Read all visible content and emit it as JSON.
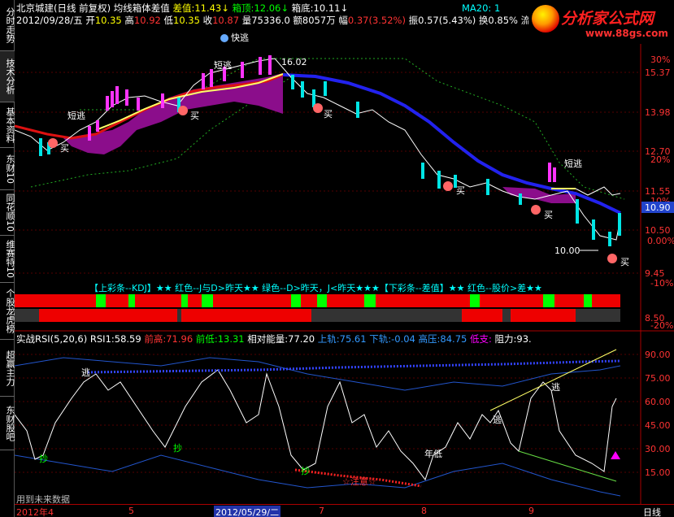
{
  "sidebar": {
    "tabs": [
      "分时走势",
      "技术分析",
      "基本资料",
      "东财10",
      "同花顺10",
      "维赛特10",
      "个股龙虎榜",
      "超赢主力",
      "东财股吧"
    ]
  },
  "header": {
    "stock": "北京城建(日线 前复权)",
    "indicator": "均线箱体差值",
    "diff_label": "差值:",
    "diff_value": "11.43",
    "top_label": "箱顶:",
    "top_value": "12.06",
    "bottom_label": "箱底:",
    "bottom_value": "10.11",
    "date": "2012/09/28/五",
    "open_label": "开",
    "open": "10.35",
    "high_label": "高",
    "high": "10.92",
    "low_label": "低",
    "low": "10.35",
    "close_label": "收",
    "close": "10.87",
    "vol_label": "量",
    "vol": "75336.0",
    "amt_label": "额",
    "amt": "8057万",
    "chg_label": "幅",
    "chg": "0.37(3.52%)",
    "amp_label": "振",
    "amp": "0.57(5.43%)",
    "turn_label": "换",
    "turn": "0.85%",
    "flow_label": "流"
  },
  "ma20": "MA20: 1",
  "logo": {
    "title": "分析家公式网",
    "url": "www.88gs.com"
  },
  "price_axis": [
    "15.37",
    "13.98",
    "12.70",
    "11.55",
    "10.50",
    "9.45",
    "8.50"
  ],
  "pct_axis": [
    "30%",
    "20%",
    "10%",
    "0.00%",
    "-10%",
    "-20%"
  ],
  "current_price": "10.90",
  "annotations": {
    "kuaitao": "快逃",
    "duantao": "短逃",
    "buy": "买",
    "high_mark": "16.02",
    "low_mark": "10.00"
  },
  "banner": "【上彩条--KDJ】★★ 红色--J与D>昨天★★ 绿色--D>昨天，J<昨天★★★【下彩条--差值】★★ 红色--股价>差★★",
  "rsi": {
    "name": "实战RSI(5,20,6)",
    "rsi1_label": "RSI1:",
    "rsi1": "58.59",
    "prev_high_label": "前高:",
    "prev_high": "71.96",
    "prev_low_label": "前低:",
    "prev_low": "13.31",
    "rel_label": "相对能量:",
    "rel": "77.20",
    "upper_label": "上轨:",
    "upper": "75.61",
    "lower_label": "下轨:",
    "lower": "-0.04",
    "high_press_label": "高压:",
    "high_press": "84.75",
    "low_support_label": "低支:",
    "resist_label": "阻力:",
    "resist": "93."
  },
  "rsi_axis": [
    "90.00",
    "75.00",
    "60.00",
    "45.00",
    "30.00",
    "15.00"
  ],
  "rsi_marks": {
    "tao": "逃",
    "chao": "抄",
    "niandi": "年低",
    "zhuyi": "☆注意☆"
  },
  "future_text": "用到未来数据",
  "xaxis": {
    "labels": [
      "2012年4",
      "5",
      "2012/05/29/二",
      "7",
      "8",
      "9"
    ],
    "period": "日线"
  }
}
